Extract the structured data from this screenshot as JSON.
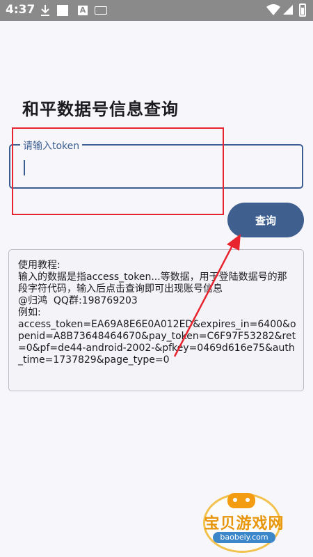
{
  "status_bar": {
    "time": "4:37",
    "icons": [
      "download-icon",
      "square-notification-icon",
      "a-notification-icon",
      "keyboard-icon",
      "wifi-icon",
      "signal-icon",
      "battery-icon"
    ]
  },
  "page": {
    "title": "和平数据号信息查询"
  },
  "token_field": {
    "label": "请输入token",
    "value": ""
  },
  "query_button": {
    "label": "查询"
  },
  "info": {
    "text": "使用教程:\n输入的数据是指access_token...等数据，用于登陆数据号的那段字符代码，输入后点击查询即可出现账号信息\n@归鸿  QQ群:198769203\n例如:\naccess_token=EA69A8E6E0A012ED&expires_in=6400&openid=A8B73648464670&pay_token=C6F97F53282&ret=0&pf=de44-android-2002-&pfkey=0469d616e75&auth_time=1737829&page_type=0"
  },
  "watermark": {
    "title": "宝贝游戏网",
    "domain": "baobeiy.com"
  },
  "colors": {
    "accent": "#3f5f8f",
    "highlight": "#e8242f",
    "background": "#f7f7fb"
  }
}
